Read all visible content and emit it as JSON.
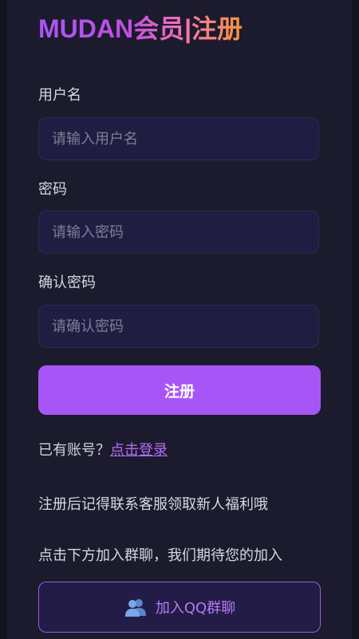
{
  "header": {
    "title": "MUDAN会员|注册"
  },
  "form": {
    "username": {
      "label": "用户名",
      "placeholder": "请输入用户名"
    },
    "password": {
      "label": "密码",
      "placeholder": "请输入密码"
    },
    "confirm_password": {
      "label": "确认密码",
      "placeholder": "请确认密码"
    },
    "submit_label": "注册"
  },
  "login": {
    "prompt": "已有账号？",
    "link_text": "点击登录"
  },
  "notes": {
    "welfare": "注册后记得联系客服领取新人福利哦",
    "group": "点击下方加入群聊，我们期待您的加入"
  },
  "qq_button": {
    "icon": "users-icon",
    "label": "加入QQ群聊"
  },
  "colors": {
    "accent": "#a855f7",
    "background": "#1b1b2d",
    "field_background": "#211d42",
    "link": "#b46cf7"
  }
}
